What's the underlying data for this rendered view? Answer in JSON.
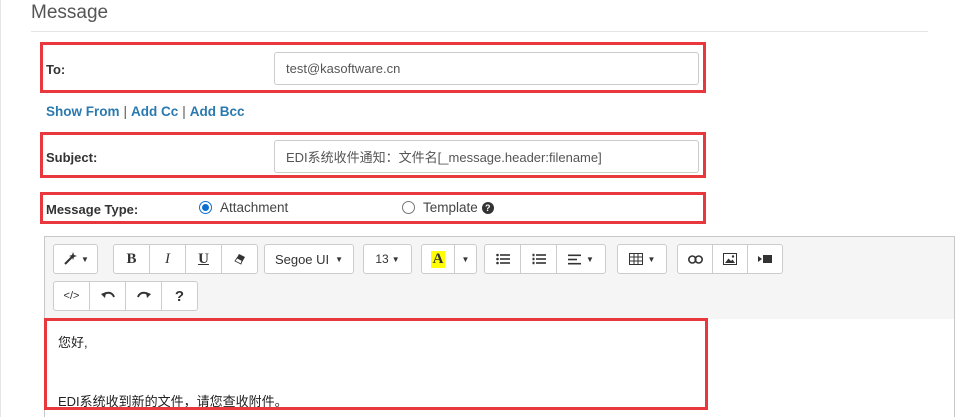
{
  "section": {
    "title": "Message"
  },
  "to": {
    "label": "To:",
    "value": "test@kasoftware.cn"
  },
  "links": {
    "show_from": "Show From",
    "add_cc": "Add Cc",
    "add_bcc": "Add Bcc",
    "separator": "|"
  },
  "subject": {
    "label": "Subject:",
    "value": "EDI系统收件通知：文件名[_message.header:filename]"
  },
  "message_type": {
    "label": "Message Type:",
    "options": [
      {
        "label": "Attachment",
        "selected": true
      },
      {
        "label": "Template",
        "selected": false
      }
    ],
    "help_icon": "question-circle-icon"
  },
  "toolbar": {
    "magic": "magic-wand-icon",
    "bold": "B",
    "italic": "I",
    "underline": "U",
    "eraser": "eraser-icon",
    "font_name": "Segoe UI",
    "font_size": "13",
    "color_letter": "A",
    "color_highlight": "#ffff00",
    "ul": "unordered-list-icon",
    "ol": "ordered-list-icon",
    "align": "align-left-icon",
    "table": "table-icon",
    "link": "link-icon",
    "picture": "picture-icon",
    "video": "video-icon",
    "code": "</>",
    "undo": "undo-icon",
    "redo": "redo-icon",
    "help": "?"
  },
  "body": {
    "line1": "您好,",
    "line2": "EDI系统收到新的文件，请您查收附件。"
  },
  "colors": {
    "highlight": "#e8383d",
    "link": "#2a7ab0",
    "radio": "#0b6ed1"
  }
}
